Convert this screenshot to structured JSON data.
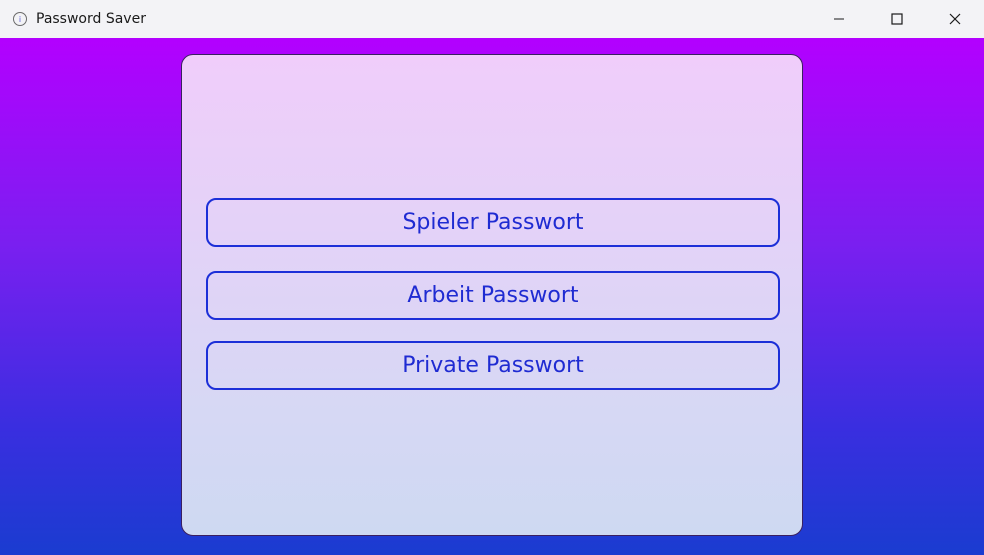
{
  "window": {
    "title": "Password Saver",
    "controls": {
      "minimize": "minimize-icon",
      "maximize": "maximize-icon",
      "close": "close-icon"
    }
  },
  "panel": {
    "buttons": [
      {
        "label": "Spieler Passwort"
      },
      {
        "label": "Arbeit Passwort"
      },
      {
        "label": "Private Passwort"
      }
    ]
  },
  "colors": {
    "background_top": "#b300ff",
    "background_bottom": "#1a3cd0",
    "button_border": "#1c2fd8",
    "button_text": "#1f2bd2"
  }
}
